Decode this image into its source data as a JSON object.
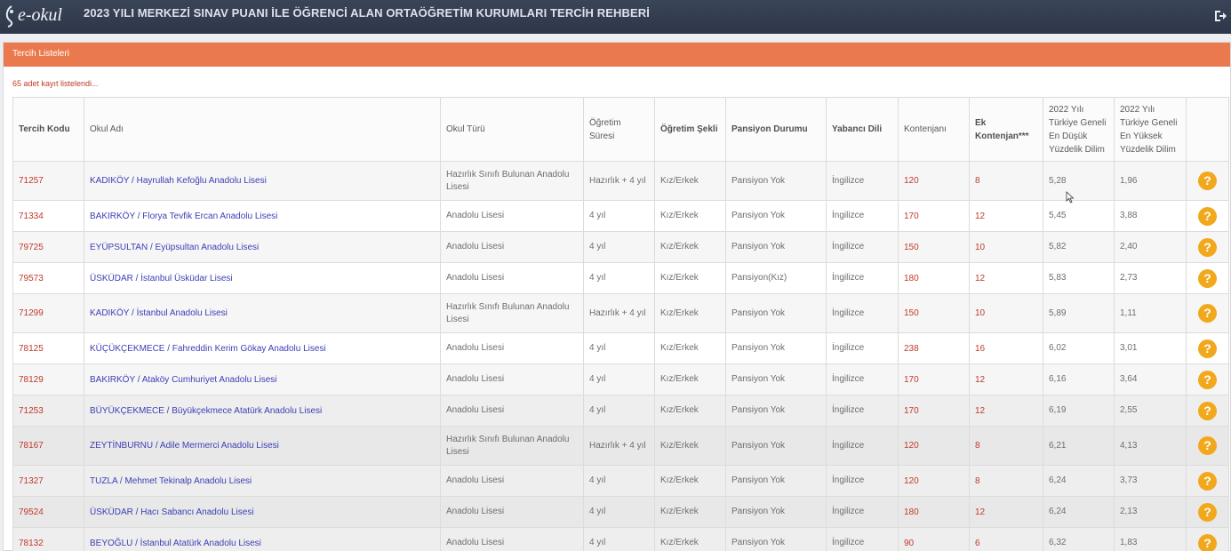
{
  "app": {
    "logo_text": "e-okul",
    "title": "2023 YILI MERKEZİ SINAV PUANI İLE ÖĞRENCİ ALAN ORTAÖĞRETİM KURUMLARI TERCİH REHBERİ",
    "logout_icon": "logout-icon"
  },
  "panel": {
    "title": "Tercih Listeleri",
    "record_count": "65 adet kayıt listelendi..."
  },
  "colors": {
    "topbar": "#2e3749",
    "panel_header": "#ea7a4d",
    "code_red": "#c0392b",
    "link_blue": "#3b3fb5",
    "help_orange": "#f2a81d"
  },
  "table": {
    "headers": {
      "code": "Tercih Kodu",
      "school": "Okul Adı",
      "type": "Okul Türü",
      "duration_1": "Öğretim",
      "duration_2": "Süresi",
      "mode": "Öğretim Şekli",
      "boarding": "Pansiyon Durumu",
      "language": "Yabancı Dili",
      "quota": "Kontenjanı",
      "extra_1": "Ek",
      "extra_2": "Kontenjan***",
      "low_1": "2022 Yılı",
      "low_2": "Türkiye Geneli",
      "low_3": "En Düşük",
      "low_4": "Yüzdelik Dilim",
      "high_1": "2022 Yılı",
      "high_2": "Türkiye Geneli",
      "high_3": "En Yüksek",
      "high_4": "Yüzdelik Dilim"
    },
    "rows": [
      {
        "code": "71257",
        "school": "KADIKÖY / Hayrullah Kefoğlu Anadolu Lisesi",
        "type": "Hazırlık Sınıfı Bulunan Anadolu Lisesi",
        "duration": "Hazırlık + 4 yıl",
        "mode": "Kız/Erkek",
        "boarding": "Pansiyon Yok",
        "language": "İngilizce",
        "quota": "120",
        "extra": "8",
        "low": "5,28",
        "high": "1,96"
      },
      {
        "code": "71334",
        "school": "BAKIRKÖY / Florya Tevfik Ercan Anadolu Lisesi",
        "type": "Anadolu Lisesi",
        "duration": "4 yıl",
        "mode": "Kız/Erkek",
        "boarding": "Pansiyon Yok",
        "language": "İngilizce",
        "quota": "170",
        "extra": "12",
        "low": "5,45",
        "high": "3,88"
      },
      {
        "code": "79725",
        "school": "EYÜPSULTAN / Eyüpsultan Anadolu Lisesi",
        "type": "Anadolu Lisesi",
        "duration": "4 yıl",
        "mode": "Kız/Erkek",
        "boarding": "Pansiyon Yok",
        "language": "İngilizce",
        "quota": "150",
        "extra": "10",
        "low": "5,82",
        "high": "2,40"
      },
      {
        "code": "79573",
        "school": "ÜSKÜDAR / İstanbul Üsküdar Lisesi",
        "type": "Anadolu Lisesi",
        "duration": "4 yıl",
        "mode": "Kız/Erkek",
        "boarding": "Pansiyon(Kız)",
        "language": "İngilizce",
        "quota": "180",
        "extra": "12",
        "low": "5,83",
        "high": "2,73"
      },
      {
        "code": "71299",
        "school": "KADIKÖY / İstanbul Anadolu Lisesi",
        "type": "Hazırlık Sınıfı Bulunan Anadolu Lisesi",
        "duration": "Hazırlık + 4 yıl",
        "mode": "Kız/Erkek",
        "boarding": "Pansiyon Yok",
        "language": "İngilizce",
        "quota": "150",
        "extra": "10",
        "low": "5,89",
        "high": "1,11"
      },
      {
        "code": "78125",
        "school": "KÜÇÜKÇEKMECE / Fahreddin Kerim Gökay Anadolu Lisesi",
        "type": "Anadolu Lisesi",
        "duration": "4 yıl",
        "mode": "Kız/Erkek",
        "boarding": "Pansiyon Yok",
        "language": "İngilizce",
        "quota": "238",
        "extra": "16",
        "low": "6,02",
        "high": "3,01"
      },
      {
        "code": "78129",
        "school": "BAKIRKÖY / Ataköy Cumhuriyet Anadolu Lisesi",
        "type": "Anadolu Lisesi",
        "duration": "4 yıl",
        "mode": "Kız/Erkek",
        "boarding": "Pansiyon Yok",
        "language": "İngilizce",
        "quota": "170",
        "extra": "12",
        "low": "6,16",
        "high": "3,64"
      },
      {
        "code": "71253",
        "school": "BÜYÜKÇEKMECE / Büyükçekmece Atatürk Anadolu Lisesi",
        "type": "Anadolu Lisesi",
        "duration": "4 yıl",
        "mode": "Kız/Erkek",
        "boarding": "Pansiyon Yok",
        "language": "İngilizce",
        "quota": "170",
        "extra": "12",
        "low": "6,19",
        "high": "2,55"
      },
      {
        "code": "78167",
        "school": "ZEYTİNBURNU / Adile Mermerci Anadolu Lisesi",
        "type": "Hazırlık Sınıfı Bulunan Anadolu Lisesi",
        "duration": "Hazırlık + 4 yıl",
        "mode": "Kız/Erkek",
        "boarding": "Pansiyon Yok",
        "language": "İngilizce",
        "quota": "120",
        "extra": "8",
        "low": "6,21",
        "high": "4,13"
      },
      {
        "code": "71327",
        "school": "TUZLA / Mehmet Tekinalp Anadolu Lisesi",
        "type": "Anadolu Lisesi",
        "duration": "4 yıl",
        "mode": "Kız/Erkek",
        "boarding": "Pansiyon Yok",
        "language": "İngilizce",
        "quota": "120",
        "extra": "8",
        "low": "6,24",
        "high": "3,73"
      },
      {
        "code": "79524",
        "school": "ÜSKÜDAR / Hacı Sabancı Anadolu Lisesi",
        "type": "Anadolu Lisesi",
        "duration": "4 yıl",
        "mode": "Kız/Erkek",
        "boarding": "Pansiyon Yok",
        "language": "İngilizce",
        "quota": "180",
        "extra": "12",
        "low": "6,24",
        "high": "2,13"
      },
      {
        "code": "78132",
        "school": "BEYOĞLU / İstanbul Atatürk Anadolu Lisesi",
        "type": "Anadolu Lisesi",
        "duration": "4 yıl",
        "mode": "Kız/Erkek",
        "boarding": "Pansiyon Yok",
        "language": "İngilizce",
        "quota": "90",
        "extra": "6",
        "low": "6,32",
        "high": "1,83"
      }
    ],
    "help_glyph": "?"
  }
}
